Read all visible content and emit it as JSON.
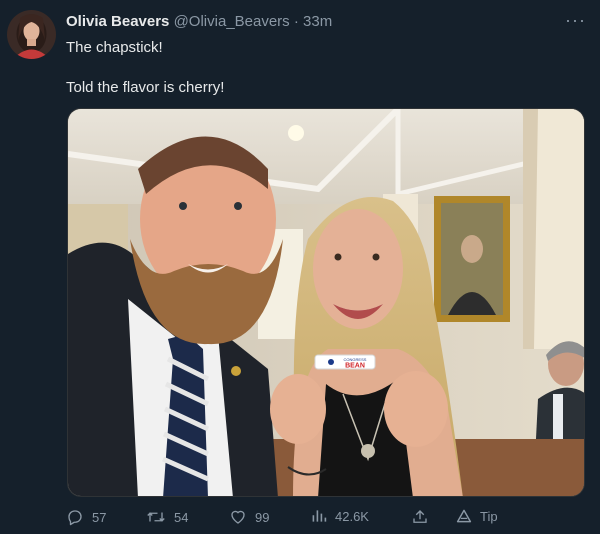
{
  "tweet": {
    "author_name": "Olivia Beavers",
    "author_handle": "@Olivia_Beavers",
    "separator": "·",
    "time": "33m",
    "more_label": "···",
    "text_line1": "The chapstick!",
    "text_line2": "Told the flavor is cherry!",
    "chapstick_label_top": "CONGRESS",
    "chapstick_label_main": "BEAN"
  },
  "actions": {
    "reply_count": "57",
    "retweet_count": "54",
    "like_count": "99",
    "views_count": "42.6K",
    "tip_label": "Tip"
  },
  "colors": {
    "background": "#15202b",
    "text_primary": "#e7e9ea",
    "text_secondary": "#8b98a5",
    "border": "#2f3336"
  },
  "icons": [
    "more-icon",
    "reply-icon",
    "retweet-icon",
    "like-icon",
    "views-icon",
    "share-icon",
    "tip-icon"
  ]
}
